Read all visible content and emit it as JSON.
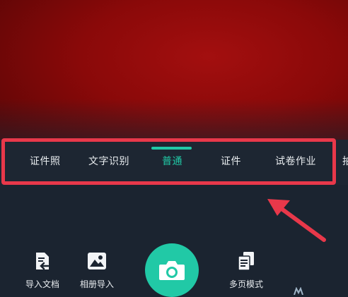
{
  "mode_tabs": [
    {
      "label": "证件照"
    },
    {
      "label": "文字识别"
    },
    {
      "label": "普通",
      "active": true
    },
    {
      "label": "证件"
    },
    {
      "label": "试卷作业"
    },
    {
      "label": "拍"
    }
  ],
  "bottom_actions": {
    "import_doc": {
      "label": "导入文档",
      "icon": "import-document-icon"
    },
    "album_import": {
      "label": "相册导入",
      "icon": "image-icon"
    },
    "shutter": {
      "icon": "camera-icon"
    },
    "multi_page": {
      "label": "多页模式",
      "icon": "multi-page-icon"
    }
  },
  "colors": {
    "accent": "#21c9a6",
    "annotation": "#e8384a",
    "panel": "#1b2430"
  }
}
